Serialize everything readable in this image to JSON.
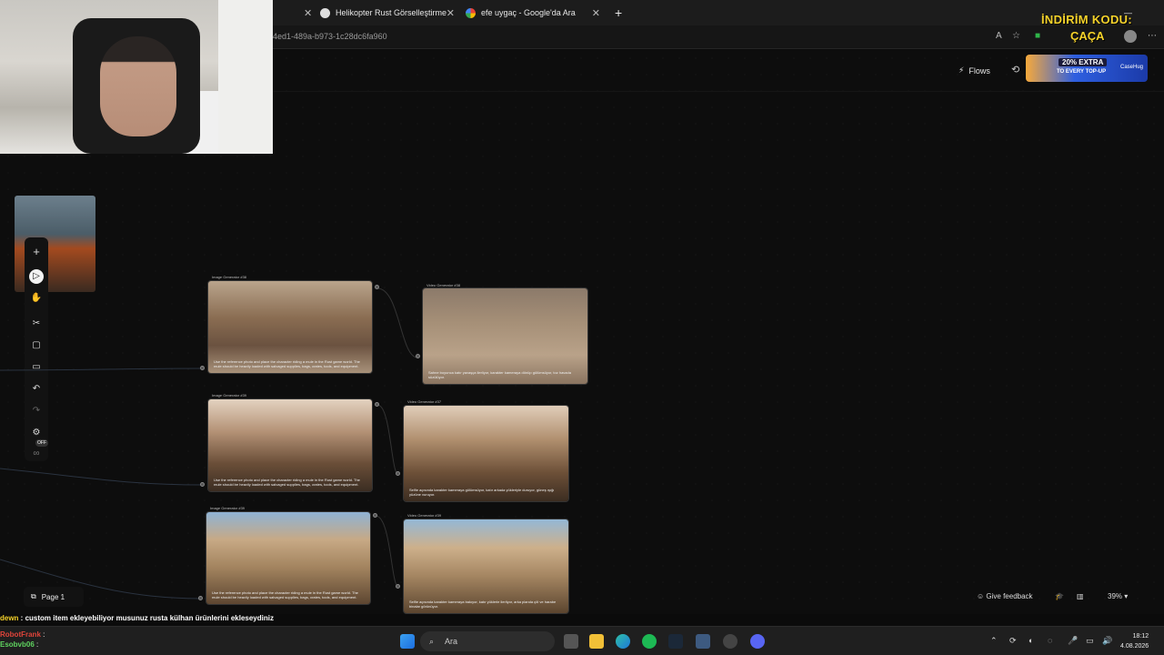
{
  "browser": {
    "tabs": [
      {
        "label": "Helikopter Rust Görselleştirme"
      },
      {
        "label": "efe uygaç - Google'da Ara"
      }
    ],
    "url": "4ed1-489a-b973-1c28dc6fa960"
  },
  "app": {
    "flows_label": "Flows",
    "promo": {
      "line1": "20% EXTRA",
      "line2": "TO EVERY TOP-UP",
      "brand": "CaseHug"
    },
    "toolbar": {
      "off_badge": "OFF"
    },
    "page_label": "Page 1",
    "feedback_label": "Give feedback",
    "zoom": "39%",
    "nodes": [
      {
        "title": "Image Generator #38",
        "caption": "Use the reference photo and place the character riding a mule in the Rust game world. The mule should be heavily loaded with salvaged supplies, bags, crates, tools, and equipment."
      },
      {
        "title": "Video Generator #38",
        "caption": "Sahne boyunca katır yavaşça ilerliyor, karakter kameraya dönüp gülümsüyor, toz havada süzülüyor."
      },
      {
        "title": "Image Generator #39",
        "caption": "Use the reference photo and place the character riding a mule in the Rust game world. The mule should be heavily loaded with salvaged supplies, bags, crates, tools, and equipment."
      },
      {
        "title": "Video Generator #37",
        "caption": "Selfie açısında karakter kameraya gülümsüyor, katır arkada yükleriyle duruyor, güneş ışığı yüzüne vuruyor."
      },
      {
        "title": "Image Generator #39",
        "caption": "Use the reference photo and place the character riding a mule in the Rust game world. The mule should be heavily loaded with salvaged supplies, bags, crates, tools, and equipment."
      },
      {
        "title": "Video Generator #39",
        "caption": "Selfie açısında karakter kameraya bakıyor, katır yüklerle ilerliyor, arka planda çöl ve harabe binalar görünüyor."
      }
    ]
  },
  "overlay": {
    "title_line1": "İNDİRİM KODU:",
    "title_line2": "ÇAÇA",
    "chat": [
      {
        "user": "dewn",
        "message": " : custom item ekleyebiliyor musunuz rusta külhan ürünlerini ekleseydiniz",
        "color": "#f5d22a"
      },
      {
        "user": "RobotFrank",
        "message": " : ",
        "color": "#e0443a"
      },
      {
        "user": "Esobvb06",
        "message": " : ",
        "color": "#5fd35f"
      }
    ]
  },
  "taskbar": {
    "search_placeholder": "Ara",
    "time": "18:12",
    "date": "4.08.2026"
  }
}
